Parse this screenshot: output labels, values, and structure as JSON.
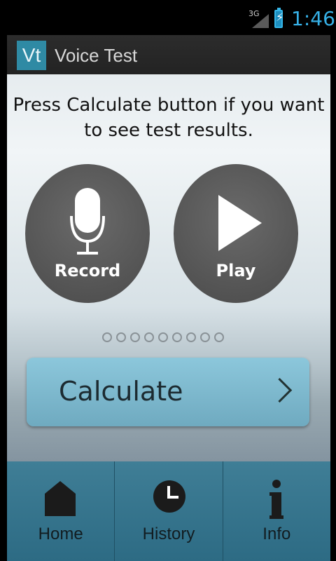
{
  "statusbar": {
    "network": "3G",
    "time": "1:46"
  },
  "actionbar": {
    "logo_text": "Vt",
    "title": "Voice Test"
  },
  "main": {
    "instruction": "Press Calculate button if you want to see test results.",
    "record_label": "Record",
    "play_label": "Play",
    "page_indicator_count": 9,
    "calculate_label": "Calculate"
  },
  "bottomnav": {
    "items": [
      {
        "label": "Home",
        "icon": "home-icon"
      },
      {
        "label": "History",
        "icon": "clock-icon"
      },
      {
        "label": "Info",
        "icon": "info-icon"
      }
    ]
  },
  "colors": {
    "accent": "#36b0e6",
    "logo_bg": "#2f8aa4",
    "calculate_bg": "#7bb8cd",
    "nav_bg": "#3a7a92"
  }
}
